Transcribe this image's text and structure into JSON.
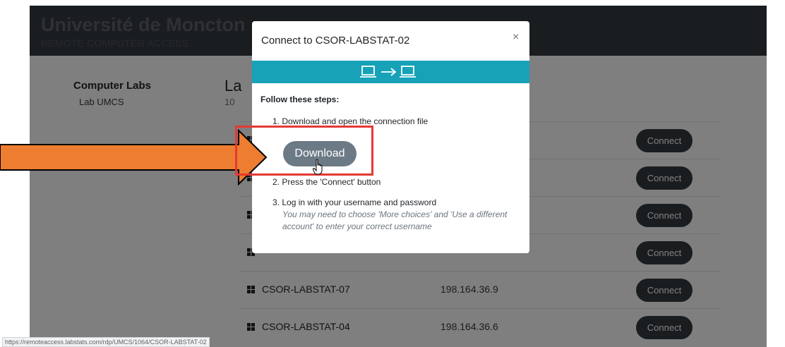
{
  "header": {
    "title": "Université de Moncton",
    "subtitle": "REMOTE COMPUTER ACCESS"
  },
  "sidebar": {
    "title": "Computer Labs",
    "items": [
      {
        "label": "Lab UMCS"
      }
    ]
  },
  "main": {
    "title": "La",
    "subtitle": "10"
  },
  "computers": [
    {
      "name": "",
      "ip": "",
      "action": "Connect"
    },
    {
      "name": "",
      "ip": "",
      "action": "Connect"
    },
    {
      "name": "",
      "ip": "",
      "action": "Connect"
    },
    {
      "name": "",
      "ip": "",
      "action": "Connect"
    },
    {
      "name": "CSOR-LABSTAT-07",
      "ip": "198.164.36.9",
      "action": "Connect"
    },
    {
      "name": "CSOR-LABSTAT-04",
      "ip": "198.164.36.6",
      "action": "Connect"
    }
  ],
  "modal": {
    "title": "Connect to CSOR-LABSTAT-02",
    "close": "×",
    "banner_icon": "computer-arrow-computer-icon",
    "steps_heading": "Follow these steps:",
    "step1": "1. Download and open the connection file",
    "download_label": "Download",
    "step2": "2. Press the 'Connect' button",
    "step3": "3. Log in with your username and password",
    "step3_note_line1": "You may need to choose 'More choices' and 'Use a different",
    "step3_note_line2": "account' to enter your correct username"
  },
  "annotation": {
    "arrow_color": "#ed7d31",
    "highlight_color": "#e53935"
  },
  "status_bar": {
    "url": "https://remoteaccess.labstats.com/rdp/UMCS/1064/CSOR-LABSTAT-02"
  },
  "colors": {
    "header_bg": "#343a40",
    "banner": "#17a2b8",
    "download_button": "#6c7a86",
    "connect_button": "#343a40"
  }
}
